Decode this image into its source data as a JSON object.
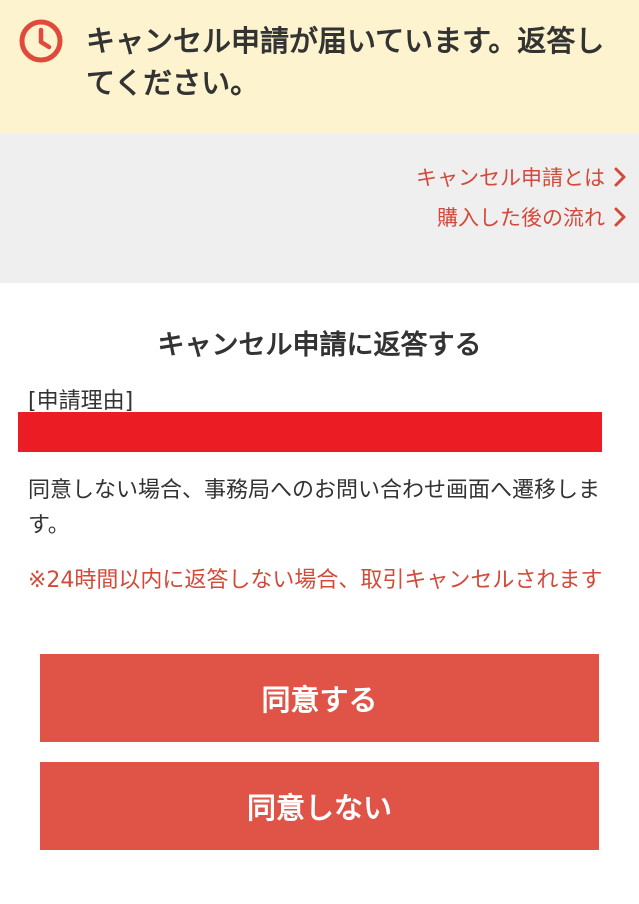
{
  "banner": {
    "icon": "clock-icon",
    "message": "キャンセル申請が届いています。返答してください。",
    "accent": "#e04a3c"
  },
  "links": [
    {
      "label": "キャンセル申請とは",
      "icon": "chevron-right-icon"
    },
    {
      "label": "購入した後の流れ",
      "icon": "chevron-right-icon"
    }
  ],
  "main": {
    "title": "キャンセル申請に返答する",
    "reason_label": "[申請理由]",
    "description": "同意しない場合、事務局へのお問い合わせ画面へ遷移します。",
    "warning": "※24時間以内に返答しない場合、取引キャンセルされます"
  },
  "buttons": {
    "agree": "同意する",
    "disagree": "同意しない"
  },
  "colors": {
    "banner_bg": "#fdf4cf",
    "link": "#d34a3a",
    "button": "#e05448",
    "redaction": "#ec1c24"
  }
}
